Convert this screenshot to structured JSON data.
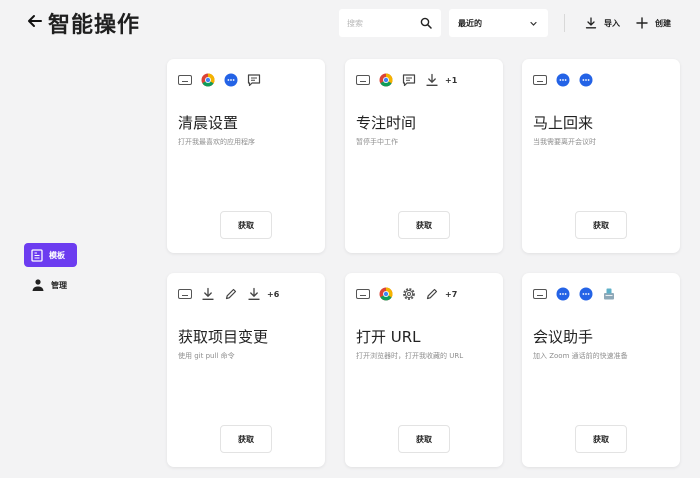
{
  "header": {
    "title": "智能操作",
    "search_placeholder": "搜索",
    "sort_value": "最近的",
    "import_label": "导入",
    "create_label": "创建"
  },
  "sidebar": {
    "items": [
      {
        "label": "模板",
        "icon": "template-icon",
        "active": true
      },
      {
        "label": "管理",
        "icon": "person-icon",
        "active": false
      }
    ]
  },
  "colors": {
    "accent": "#6c3cf0",
    "background": "#f3f3f4",
    "card": "#ffffff"
  },
  "cards": [
    {
      "title": "清晨设置",
      "description": "打开我最喜欢的应用程序",
      "button": "获取",
      "icons": [
        "keyboard-icon",
        "chrome-icon",
        "dots-app-icon",
        "message-icon"
      ],
      "extra": ""
    },
    {
      "title": "专注时间",
      "description": "暂停手中工作",
      "button": "获取",
      "icons": [
        "keyboard-icon",
        "chrome-icon",
        "message-icon",
        "download-icon"
      ],
      "extra": "+1"
    },
    {
      "title": "马上回来",
      "description": "当我需要离开会议时",
      "button": "获取",
      "icons": [
        "keyboard-icon",
        "dots-app-icon",
        "dots-app-icon"
      ],
      "extra": ""
    },
    {
      "title": "获取项目变更",
      "description": "使用 git pull 命令",
      "button": "获取",
      "icons": [
        "keyboard-icon",
        "download-icon",
        "pencil-icon",
        "download-icon"
      ],
      "extra": "+6"
    },
    {
      "title": "打开 URL",
      "description": "打开浏览器时，打开我收藏的 URL",
      "button": "获取",
      "icons": [
        "keyboard-icon",
        "chrome-icon",
        "gear-icon",
        "pencil-icon"
      ],
      "extra": "+7"
    },
    {
      "title": "会议助手",
      "description": "加入 Zoom 通话前的快速准备",
      "button": "获取",
      "icons": [
        "keyboard-icon",
        "dots-app-icon",
        "dots-app-icon",
        "brush-icon"
      ],
      "extra": ""
    }
  ]
}
